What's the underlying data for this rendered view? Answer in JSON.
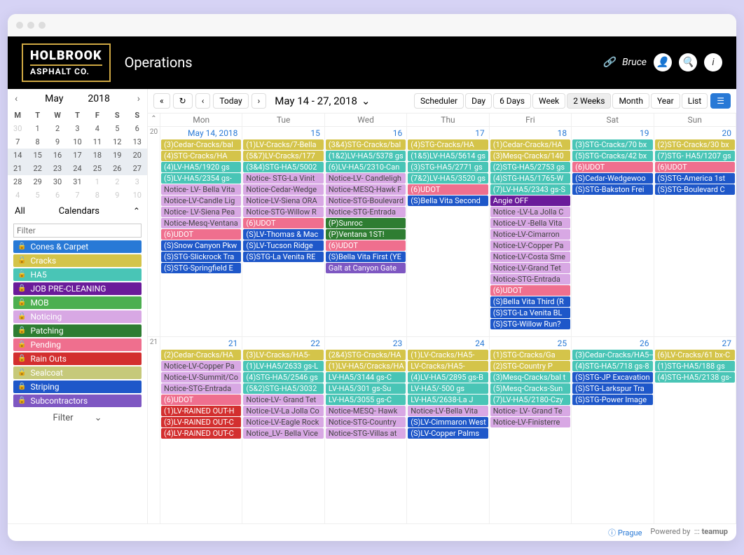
{
  "header": {
    "brand_l1": "HOLBROOK",
    "brand_l2": "ASPHALT CO.",
    "title": "Operations",
    "user": "Bruce"
  },
  "mini": {
    "month": "May",
    "year": "2018",
    "dow": [
      "M",
      "T",
      "W",
      "T",
      "F",
      "S",
      "S"
    ],
    "rows": [
      [
        "30",
        "1",
        "2",
        "3",
        "4",
        "5",
        "6"
      ],
      [
        "7",
        "8",
        "9",
        "10",
        "11",
        "12",
        "13"
      ],
      [
        "14",
        "15",
        "16",
        "17",
        "18",
        "19",
        "20"
      ],
      [
        "21",
        "22",
        "23",
        "24",
        "25",
        "26",
        "27"
      ],
      [
        "28",
        "29",
        "30",
        "31",
        "1",
        "2",
        "3"
      ],
      [
        "4",
        "5",
        "6",
        "7",
        "8",
        "9",
        "10"
      ]
    ],
    "sel_rows": [
      2,
      3
    ],
    "muted": [
      [
        0,
        0
      ],
      [
        4,
        4
      ],
      [
        4,
        5
      ],
      [
        4,
        6
      ],
      [
        5,
        0
      ],
      [
        5,
        1
      ],
      [
        5,
        2
      ],
      [
        5,
        3
      ],
      [
        5,
        4
      ],
      [
        5,
        5
      ],
      [
        5,
        6
      ]
    ]
  },
  "sidebar": {
    "all": "All",
    "calendars": "Calendars",
    "filter_ph": "Filter",
    "filter_label": "Filter",
    "cals": [
      {
        "label": "Cones & Carpet",
        "color": "#2879d6"
      },
      {
        "label": "Cracks",
        "color": "#d4c44a"
      },
      {
        "label": "HA5",
        "color": "#49c5b6"
      },
      {
        "label": "JOB PRE-CLEANING",
        "color": "#6a1b9a"
      },
      {
        "label": "MOB",
        "color": "#4caf50"
      },
      {
        "label": "Noticing",
        "color": "#d8a8e4"
      },
      {
        "label": "Patching",
        "color": "#2e7d32"
      },
      {
        "label": "Pending",
        "color": "#ef6f8e"
      },
      {
        "label": "Rain Outs",
        "color": "#d32f2f"
      },
      {
        "label": "Sealcoat",
        "color": "#c6c97a"
      },
      {
        "label": "Striping",
        "color": "#1e57c9"
      },
      {
        "label": "Subcontractors",
        "color": "#7e57c2"
      }
    ]
  },
  "toolbar": {
    "today": "Today",
    "range": "May 14 - 27, 2018",
    "views": [
      "Scheduler",
      "Day",
      "6 Days",
      "Week",
      "2 Weeks",
      "Month",
      "Year",
      "List"
    ],
    "active": "2 Weeks"
  },
  "grid": {
    "days": [
      "Mon",
      "Tue",
      "Wed",
      "Thu",
      "Fri",
      "Sat",
      "Sun"
    ],
    "weeks": [
      {
        "num": "20",
        "days": [
          {
            "date": "May 14, 2018",
            "evts": [
              {
                "t": "(3)Cedar-Cracks/bal",
                "c": "#d4c44a"
              },
              {
                "t": "(4)STG-Cracks/HA",
                "c": "#d4c44a"
              },
              {
                "t": "(4)LV-HA5/1920 gs",
                "c": "#49c5b6"
              },
              {
                "t": "(5)LV-HA5/2354 gs-",
                "c": "#49c5b6"
              },
              {
                "t": "Notice- LV- Bella Vita",
                "c": "#d8a8e4",
                "dk": 1
              },
              {
                "t": "Notice-LV-Candle Lig",
                "c": "#d8a8e4",
                "dk": 1
              },
              {
                "t": "Notice- LV-Siena Pea",
                "c": "#d8a8e4",
                "dk": 1
              },
              {
                "t": "Notice-Mesq-Ventana",
                "c": "#d8a8e4",
                "dk": 1
              },
              {
                "t": "(6)UDOT",
                "c": "#ef6f8e"
              },
              {
                "t": "(S)Snow Canyon Pkw",
                "c": "#1e57c9"
              },
              {
                "t": "(S)STG-Slickrock Tra",
                "c": "#1e57c9"
              },
              {
                "t": "(S)STG-Springfield E",
                "c": "#1e57c9"
              }
            ]
          },
          {
            "date": "15",
            "evts": [
              {
                "t": "(1)LV-Cracks/7-Bella",
                "c": "#d4c44a"
              },
              {
                "t": "(5&7)LV-Cracks/177",
                "c": "#d4c44a"
              },
              {
                "t": "(3&4)STG-HA5/5002",
                "c": "#49c5b6"
              },
              {
                "t": "Notice- STG-La Vinit",
                "c": "#d8a8e4",
                "dk": 1
              },
              {
                "t": "Notice-Cedar-Wedge",
                "c": "#d8a8e4",
                "dk": 1
              },
              {
                "t": "Notice-LV-Siena ORA",
                "c": "#d8a8e4",
                "dk": 1
              },
              {
                "t": "Notice-STG-Willow R",
                "c": "#d8a8e4",
                "dk": 1
              },
              {
                "t": "(6)UDOT",
                "c": "#ef6f8e"
              },
              {
                "t": "(S)LV-Thomas & Mac",
                "c": "#1e57c9"
              },
              {
                "t": "(S)LV-Tucson Ridge",
                "c": "#1e57c9"
              },
              {
                "t": "(S)STG-La Venita RE",
                "c": "#1e57c9"
              }
            ]
          },
          {
            "date": "16",
            "evts": [
              {
                "t": "(3&4)STG-Cracks/bal",
                "c": "#d4c44a"
              },
              {
                "t": "(1&2)LV-HA5/5378 gs",
                "c": "#49c5b6"
              },
              {
                "t": "(6)LV-HA5/2310-Can",
                "c": "#49c5b6"
              },
              {
                "t": "Notice-LV- Candleligh",
                "c": "#d8a8e4",
                "dk": 1
              },
              {
                "t": "Notice-MESQ-Hawk F",
                "c": "#d8a8e4",
                "dk": 1
              },
              {
                "t": "Notice-STG-Boulevard",
                "c": "#d8a8e4",
                "dk": 1
              },
              {
                "t": "Notice-STG-Entrada",
                "c": "#d8a8e4",
                "dk": 1
              },
              {
                "t": "(P)Sunroc",
                "c": "#2e7d32"
              },
              {
                "t": "(P)Ventana 1ST!",
                "c": "#2e7d32"
              },
              {
                "t": "(6)UDOT",
                "c": "#ef6f8e"
              },
              {
                "t": "(S)Bella Vita First (YE",
                "c": "#1e57c9"
              },
              {
                "t": "Galt at Canyon Gate",
                "c": "#7e57c2"
              }
            ]
          },
          {
            "date": "17",
            "evts": [
              {
                "t": "(4)STG-Cracks/HA",
                "c": "#d4c44a"
              },
              {
                "t": "(1&5)LV-HA5/5614 gs",
                "c": "#49c5b6"
              },
              {
                "t": "(3)STG-HA5/2771 gs",
                "c": "#49c5b6"
              },
              {
                "t": "(7&2)LV-HA5/3520 gs",
                "c": "#49c5b6"
              },
              {
                "t": "(6)UDOT",
                "c": "#ef6f8e"
              },
              {
                "t": "(S)Bella Vita Second",
                "c": "#1e57c9"
              }
            ]
          },
          {
            "date": "18",
            "evts": [
              {
                "t": "(1)Cedar-Cracks/HA",
                "c": "#d4c44a"
              },
              {
                "t": "(3)Mesq-Cracks/140",
                "c": "#d4c44a"
              },
              {
                "t": "(2)STG-HA5/2753 gs",
                "c": "#49c5b6"
              },
              {
                "t": "(4)STG-HA5/1765-W",
                "c": "#49c5b6"
              },
              {
                "t": "(7)LV-HA5/2343 gs-S",
                "c": "#49c5b6"
              },
              {
                "t": "Angie OFF",
                "c": "#6a1b9a"
              },
              {
                "t": "Notice -LV-La Jolla C",
                "c": "#d8a8e4",
                "dk": 1
              },
              {
                "t": "Notice-LV -Bella Vita",
                "c": "#d8a8e4",
                "dk": 1
              },
              {
                "t": "Notice-LV-Cimarron",
                "c": "#d8a8e4",
                "dk": 1
              },
              {
                "t": "Notice-LV-Copper Pa",
                "c": "#d8a8e4",
                "dk": 1
              },
              {
                "t": "Notice-LV-Costa Sme",
                "c": "#d8a8e4",
                "dk": 1
              },
              {
                "t": "Notice-LV-Grand Tet",
                "c": "#d8a8e4",
                "dk": 1
              },
              {
                "t": "Notice-STG-Entrada",
                "c": "#d8a8e4",
                "dk": 1
              },
              {
                "t": "(6)UDOT",
                "c": "#ef6f8e"
              },
              {
                "t": "(S)Bella Vita Third (R",
                "c": "#1e57c9"
              },
              {
                "t": "(S)STG-La Venita BL",
                "c": "#1e57c9"
              },
              {
                "t": "(S)STG-Willow Run?",
                "c": "#1e57c9"
              }
            ]
          },
          {
            "date": "19",
            "evts": [
              {
                "t": "(3)STG-Cracks/70 bx",
                "c": "#49c5b6"
              },
              {
                "t": "(5)STG-Cracks/42 bx",
                "c": "#49c5b6"
              },
              {
                "t": "(6)UDOT",
                "c": "#ef6f8e"
              },
              {
                "t": "(S)Cedar-Wedgewoo",
                "c": "#1e57c9"
              },
              {
                "t": "(S)STG-Bakston Frei",
                "c": "#1e57c9"
              }
            ]
          },
          {
            "date": "20",
            "evts": [
              {
                "t": "(2)STG-Cracks/30 bx",
                "c": "#d4c44a"
              },
              {
                "t": "(7)STG- HA5/1207 gs",
                "c": "#49c5b6"
              },
              {
                "t": "(6)UDOT",
                "c": "#ef6f8e"
              },
              {
                "t": "(S)STG-America 1st",
                "c": "#1e57c9"
              },
              {
                "t": "(S)STG-Boulevard C",
                "c": "#1e57c9"
              }
            ]
          }
        ]
      },
      {
        "num": "21",
        "days": [
          {
            "date": "21",
            "evts": [
              {
                "t": "(2)Cedar-Cracks/HA",
                "c": "#d4c44a"
              },
              {
                "t": "Notice-LV-Copper Pa",
                "c": "#d8a8e4",
                "dk": 1
              },
              {
                "t": "Notice-LV-Summit/Co",
                "c": "#d8a8e4",
                "dk": 1
              },
              {
                "t": "Notice-STG-Entrada",
                "c": "#d8a8e4",
                "dk": 1
              },
              {
                "t": "(6)UDOT",
                "c": "#ef6f8e"
              },
              {
                "t": "(1)LV-RAINED OUT-H",
                "c": "#d32f2f"
              },
              {
                "t": "(3)LV-RAINED OUT-C",
                "c": "#d32f2f"
              },
              {
                "t": "(4)LV-RAINED OUT-C",
                "c": "#d32f2f"
              }
            ]
          },
          {
            "date": "22",
            "evts": [
              {
                "t": "(3)LV-Cracks/HA5-",
                "c": "#d4c44a"
              },
              {
                "t": "(1)LV-HA5/2633 gs-L",
                "c": "#49c5b6"
              },
              {
                "t": "(4)STG-HA5/2546 gs",
                "c": "#49c5b6"
              },
              {
                "t": "(5&2)STG-HA5/3032",
                "c": "#49c5b6"
              },
              {
                "t": "Notice-LV- Grand Tet",
                "c": "#d8a8e4",
                "dk": 1
              },
              {
                "t": "Notice-LV-La Jolla Co",
                "c": "#d8a8e4",
                "dk": 1
              },
              {
                "t": "Notice-LV-Eagle Rock",
                "c": "#d8a8e4",
                "dk": 1
              },
              {
                "t": "Notice_LV- Bella Vice",
                "c": "#d8a8e4",
                "dk": 1
              }
            ]
          },
          {
            "date": "23",
            "evts": [
              {
                "t": "(2&4)STG-Cracks/HA",
                "c": "#d4c44a"
              },
              {
                "t": "(1)LV-HA5/Cracks/HA",
                "c": "#d4c44a"
              },
              {
                "t": "LV-HA5/3144 gs-C",
                "c": "#49c5b6"
              },
              {
                "t": "LV-HA5/301 gs-Su",
                "c": "#49c5b6"
              },
              {
                "t": "LV-HA5/3055 gs-C",
                "c": "#49c5b6"
              },
              {
                "t": "Notice-MESQ- Hawk",
                "c": "#d8a8e4",
                "dk": 1
              },
              {
                "t": "Notice-STG-Country",
                "c": "#d8a8e4",
                "dk": 1
              },
              {
                "t": "Notice-STG-Villas at",
                "c": "#d8a8e4",
                "dk": 1
              }
            ]
          },
          {
            "date": "24",
            "evts": [
              {
                "t": "(1)LV-Cracks/HA5-",
                "c": "#d4c44a"
              },
              {
                "t": "LV-Cracks/HA5-",
                "c": "#d4c44a"
              },
              {
                "t": "(4)LV-HA5/2895 gs-B",
                "c": "#49c5b6"
              },
              {
                "t": "LV-HA5/-500 gs",
                "c": "#49c5b6"
              },
              {
                "t": "LV-HA5/2638-La J",
                "c": "#49c5b6"
              },
              {
                "t": "Notice-LV-Bella Vita",
                "c": "#d8a8e4",
                "dk": 1
              },
              {
                "t": "(S)LV-Cimmaron West",
                "c": "#1e57c9"
              },
              {
                "t": "(S)LV-Copper Palms",
                "c": "#1e57c9"
              }
            ]
          },
          {
            "date": "25",
            "evts": [
              {
                "t": "(1)STG-Cracks/Ga",
                "c": "#d4c44a"
              },
              {
                "t": "(2)STG-Country P",
                "c": "#d4c44a"
              },
              {
                "t": "(3)Mesq-Cracks/bal t",
                "c": "#49c5b6"
              },
              {
                "t": "(5)Mesq-Cracks-Sun",
                "c": "#49c5b6"
              },
              {
                "t": "(7)LV-HA5/2180-Czy",
                "c": "#49c5b6"
              },
              {
                "t": "Notice- LV- Grand Te",
                "c": "#d8a8e4",
                "dk": 1
              },
              {
                "t": "Notice-LV-Finisterre",
                "c": "#d8a8e4",
                "dk": 1
              }
            ]
          },
          {
            "date": "26",
            "evts": [
              {
                "t": "(3)Cedar-Cracks/HA5--",
                "c": "#49c5b6"
              },
              {
                "t": "(4)STG-HA5/718 gs-8",
                "c": "#49c5b6"
              },
              {
                "t": "(S)STG-JP Excavation",
                "c": "#1e57c9"
              },
              {
                "t": "(S)STG-Larkspur Tra",
                "c": "#1e57c9"
              },
              {
                "t": "(S)STG-Power Image",
                "c": "#1e57c9"
              }
            ]
          },
          {
            "date": "27",
            "evts": [
              {
                "t": "(6)LV-Cracks/61 bx-C",
                "c": "#d4c44a"
              },
              {
                "t": "(1)STG-HA5/188 gs",
                "c": "#49c5b6"
              },
              {
                "t": "(4)STG-HA5/2138 gs-",
                "c": "#49c5b6"
              }
            ]
          }
        ]
      }
    ]
  },
  "footer": {
    "tz": "Prague",
    "powered": "Powered by",
    "brand": "teamup"
  }
}
